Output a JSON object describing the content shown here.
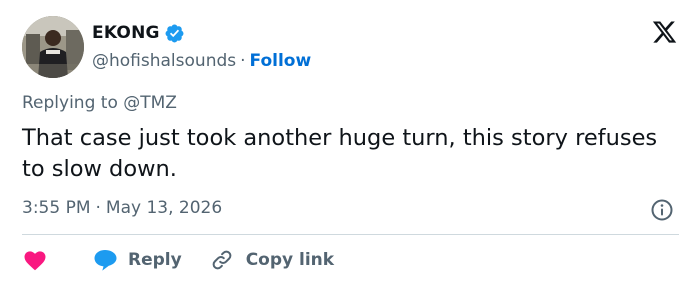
{
  "author": {
    "display_name": "EKONG",
    "handle": "@hofishalsounds",
    "separator": "·",
    "follow_label": "Follow"
  },
  "reply_context": "Replying to @TMZ",
  "tweet": {
    "text": "That case just took another huge turn, this story refuses to slow down.",
    "time": "3:55 PM",
    "separator": "·",
    "date": "May 13, 2026"
  },
  "actions": {
    "reply_label": "Reply",
    "copy_link_label": "Copy link"
  },
  "colors": {
    "accent": "#006fd6",
    "like": "#f91880",
    "reply": "#1d9bf0",
    "secondary_text": "#536471",
    "primary_text": "#0f1419"
  },
  "icons": {
    "verified": "verified-badge-icon",
    "platform": "x-logo-icon",
    "info": "info-icon",
    "like": "heart-icon",
    "reply": "speech-bubble-icon",
    "copy": "link-icon"
  }
}
